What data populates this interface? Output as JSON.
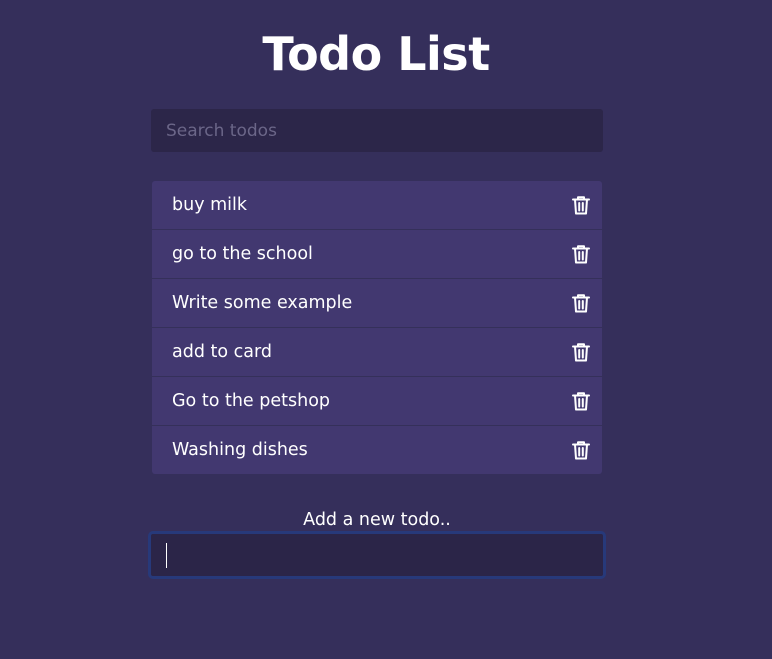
{
  "page": {
    "title": "Todo List"
  },
  "search": {
    "placeholder": "Search todos",
    "value": ""
  },
  "todos": [
    {
      "text": "buy milk",
      "icon": "trash-icon"
    },
    {
      "text": "go to the school",
      "icon": "trash-icon"
    },
    {
      "text": "Write some example",
      "icon": "trash-icon"
    },
    {
      "text": "add to card",
      "icon": "trash-icon"
    },
    {
      "text": "Go to the petshop",
      "icon": "trash-icon"
    },
    {
      "text": "Washing dishes",
      "icon": "trash-icon"
    }
  ],
  "add_form": {
    "label": "Add a new todo..",
    "value": ""
  },
  "colors": {
    "background": "#352f5b",
    "list_item": "#423870",
    "input_bg": "#2c2649",
    "focus_border": "#27397a",
    "text": "#ffffff"
  }
}
